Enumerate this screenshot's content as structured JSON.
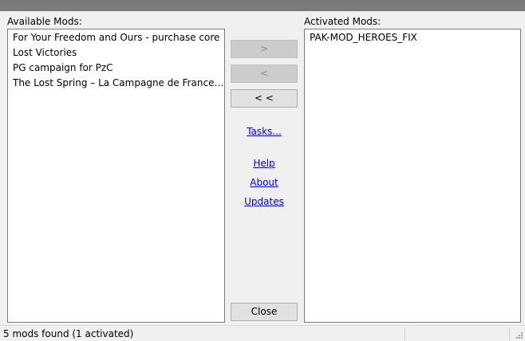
{
  "window": {
    "title_bar_color": "#7a7a7a"
  },
  "available": {
    "label": "Available Mods:",
    "items": [
      "For Your Freedom and Ours - purchase core",
      "Lost Victories",
      "PG campaign for PzC",
      "The Lost Spring – La Campagne de France - purchase core"
    ]
  },
  "activated": {
    "label": "Activated Mods:",
    "items": [
      "PAK-MOD_HEROES_FIX"
    ]
  },
  "buttons": {
    "activate": ">",
    "deactivate": "<",
    "deactivate_all": "< <",
    "close": "Close"
  },
  "links": {
    "tasks": "Tasks...",
    "help": "Help",
    "about": "About",
    "updates": "Updates"
  },
  "status": {
    "text": "5 mods found (1 activated)"
  },
  "colors": {
    "link": "#0000ee",
    "list_bg": "#ffffff",
    "window_bg": "#f0f0f0"
  }
}
